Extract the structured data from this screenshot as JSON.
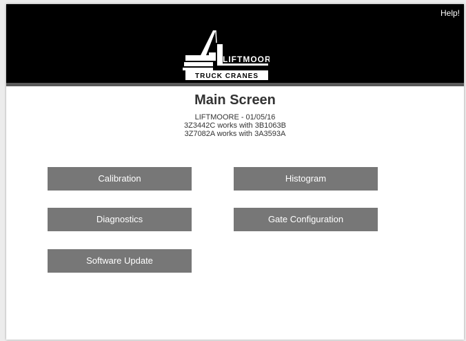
{
  "header": {
    "help_label": "Help!",
    "logo": {
      "brand_text": "LIFTMOORE",
      "tagline": "TRUCK CRANES",
      "icon": "crane-logo-icon"
    }
  },
  "main": {
    "title": "Main Screen",
    "info_lines": [
      "LIFTMOORE - 01/05/16",
      "3Z3442C works with 3B1063B",
      "3Z7082A works with 3A3593A"
    ]
  },
  "buttons": {
    "calibration": "Calibration",
    "histogram": "Histogram",
    "diagnostics": "Diagnostics",
    "gate_configuration": "Gate Configuration",
    "software_update": "Software Update"
  },
  "colors": {
    "header_bg": "#000000",
    "header_bar": "#5a5a5a",
    "button_bg": "#777777",
    "button_text": "#ffffff",
    "text": "#333333"
  }
}
